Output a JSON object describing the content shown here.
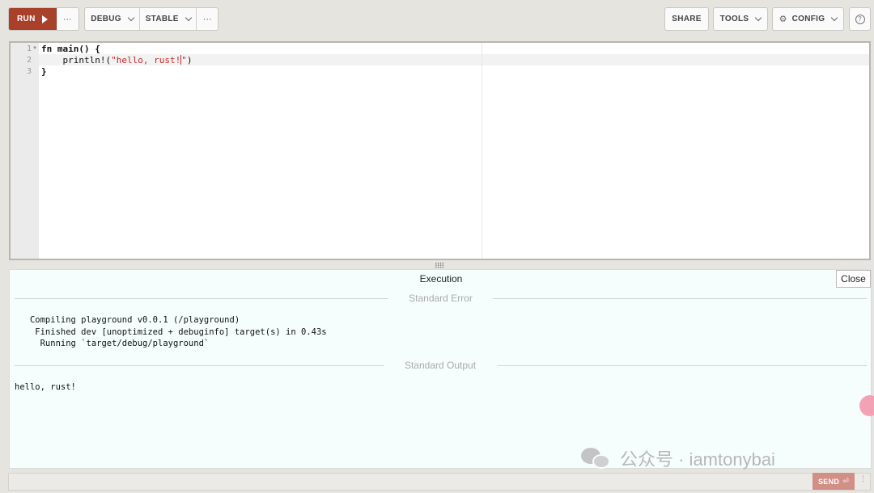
{
  "toolbar": {
    "run_label": "RUN",
    "more_label": "···",
    "mode_label": "DEBUG",
    "channel_label": "STABLE",
    "share_label": "SHARE",
    "tools_label": "TOOLS",
    "config_label": "CONFIG",
    "help_label": "?"
  },
  "editor": {
    "line_numbers": [
      "1",
      "2",
      "3"
    ],
    "lines": {
      "l1_kw": "fn",
      "l1_rest": " main() {",
      "l2_indent": "    println!(",
      "l2_str": "\"hello, rust!",
      "l2_str_end": "\"",
      "l2_end": ")",
      "l3": "}"
    }
  },
  "output": {
    "title": "Execution",
    "close_label": "Close",
    "stderr_label": "Standard Error",
    "stderr_lines": [
      "   Compiling playground v0.0.1 (/playground)",
      "    Finished dev [unoptimized + debuginfo] target(s) in 0.43s",
      "     Running `target/debug/playground`"
    ],
    "stdout_label": "Standard Output",
    "stdout_lines": [
      "hello, rust!"
    ]
  },
  "watermark": {
    "text": "公众号 · iamtonybai"
  },
  "bottom": {
    "send_label": "SEND",
    "more_label": "⋮"
  },
  "colors": {
    "run_bg": "#a9402a",
    "string": "#c32b2b",
    "output_bg": "#f6fdfd",
    "send_bg": "#d18f86"
  }
}
